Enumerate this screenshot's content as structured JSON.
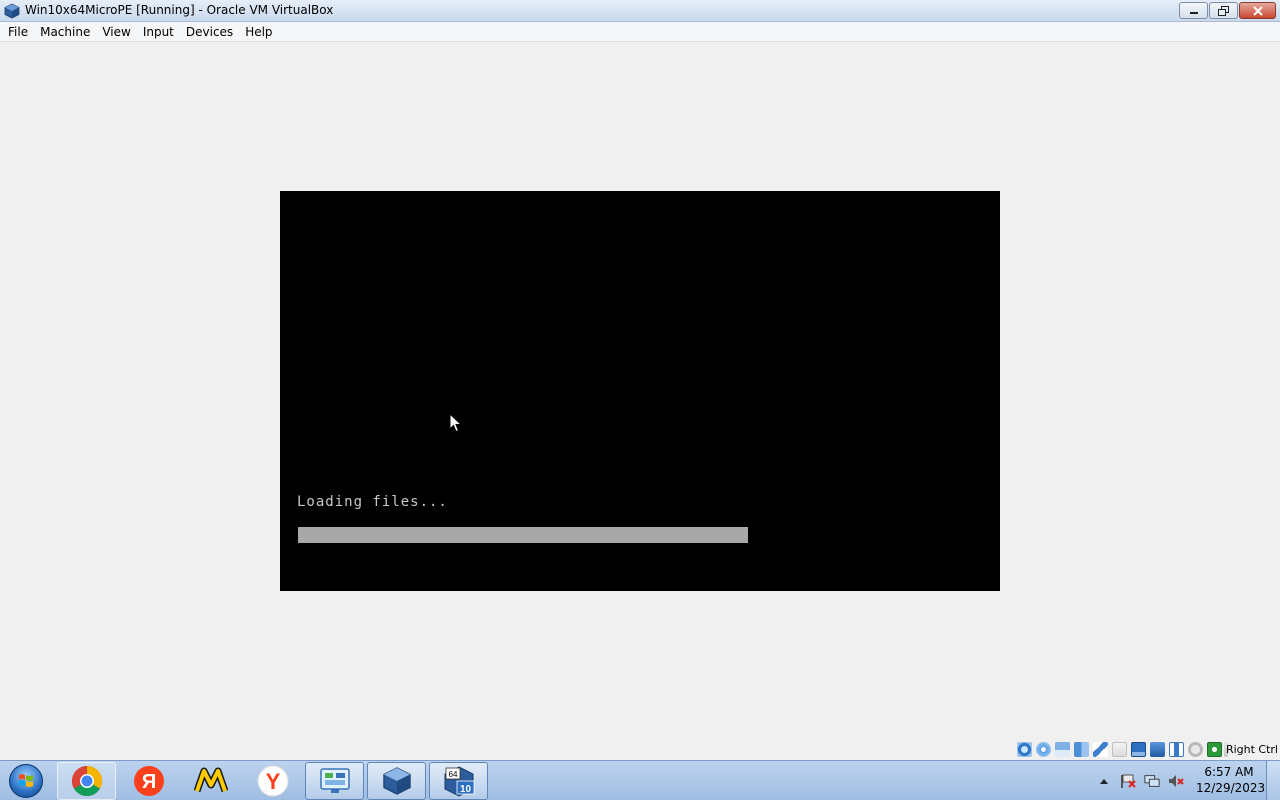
{
  "window": {
    "title": "Win10x64MicroPE [Running] - Oracle VM VirtualBox",
    "icon": "virtualbox-icon",
    "controls": [
      "minimize-icon",
      "restore-icon",
      "close-icon"
    ]
  },
  "menubar": {
    "items": [
      "File",
      "Machine",
      "View",
      "Input",
      "Devices",
      "Help"
    ]
  },
  "vm_screen": {
    "loading_text": "Loading files...",
    "progress_fraction": 1.0,
    "bg_color": "#000000",
    "text_color": "#c8c8c8",
    "progress_color": "#a8a8a8"
  },
  "statusbar": {
    "icons": [
      "hard-disk-icon",
      "optical-disk-icon",
      "floppy-icon",
      "network-icon",
      "usb-icon",
      "shared-folders-icon",
      "display-icon",
      "video-capture-icon",
      "vrde-icon",
      "cpu-icon",
      "mouse-integration-icon",
      "keyboard-capture-icon"
    ],
    "host_key": "Right Ctrl"
  },
  "taskbar": {
    "apps": [
      {
        "name": "chrome",
        "icon": "chrome-icon"
      },
      {
        "name": "yandex",
        "icon": "yandex-letter-icon",
        "glyph": "Я"
      },
      {
        "name": "yandex-market",
        "icon": "market-m-icon"
      },
      {
        "name": "yandex-browser",
        "icon": "yandex-browser-icon",
        "glyph": "Y"
      },
      {
        "name": "control-panel",
        "icon": "control-panel-icon"
      },
      {
        "name": "virtualbox",
        "icon": "virtualbox-icon"
      },
      {
        "name": "win10x64-vm",
        "icon": "vm-instance-icon",
        "glyph_top": "64",
        "glyph_bottom": "10"
      }
    ],
    "tray_icons": [
      "show-hidden-icons-icon",
      "action-center-flag-icon",
      "network-icon",
      "volume-muted-icon"
    ],
    "clock": {
      "time": "6:57 AM",
      "date": "12/29/2023"
    }
  }
}
